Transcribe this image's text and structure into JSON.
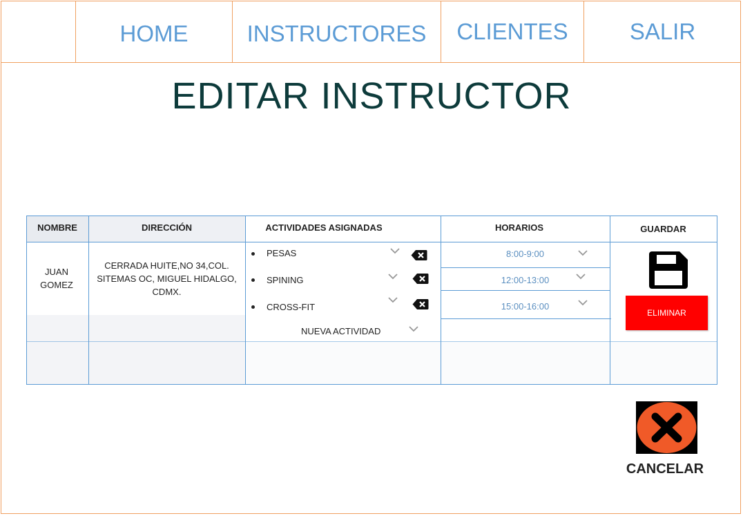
{
  "nav": {
    "home": "HOME",
    "instructores": "INSTRUCTORES",
    "clientes": "CLIENTES",
    "salir": "SALIR"
  },
  "page_title": "EDITAR INSTRUCTOR",
  "table": {
    "headers": {
      "nombre": "NOMBRE",
      "direccion": "DIRECCIÓN",
      "actividades": "ACTIVIDADES ASIGNADAS",
      "horarios": "HORARIOS",
      "guardar": "GUARDAR"
    },
    "row": {
      "nombre_line1": "JUAN",
      "nombre_line2": "GOMEZ",
      "direccion_line1": "CERRADA HUITE,NO 34,COL.",
      "direccion_line2": "SITEMAS OC, MIGUEL HIDALGO,",
      "direccion_line3": "CDMX."
    },
    "activities": [
      {
        "name": "PESAS",
        "schedule": "8:00-9:00"
      },
      {
        "name": "SPINING",
        "schedule": "12:00-13:00"
      },
      {
        "name": "CROSS-FIT",
        "schedule": "15:00-16:00"
      }
    ],
    "new_activity": "NUEVA ACTIVIDAD",
    "eliminar": "ELIMINAR"
  },
  "cancel_label": "CANCELAR",
  "colors": {
    "nav_text": "#5b9bd5",
    "border_orange": "#f0a060",
    "title": "#0d3b3b",
    "grid": "#5b9bd5",
    "danger": "#ff0000",
    "cancel_circle": "#f05a28"
  },
  "icons": [
    "save-icon",
    "backspace-icon",
    "chevron-down-icon",
    "close-icon"
  ]
}
